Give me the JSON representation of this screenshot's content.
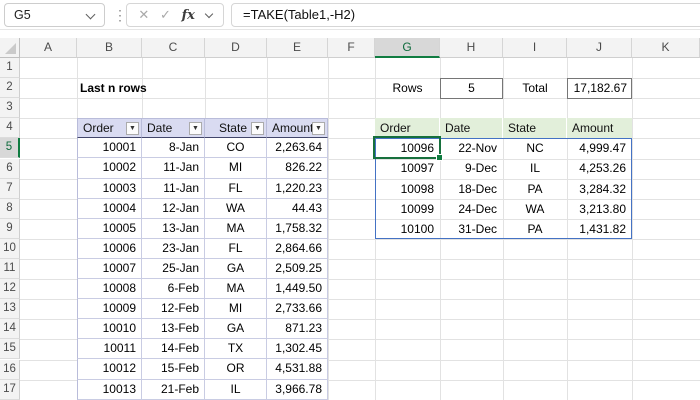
{
  "chrome": {
    "name_box": "G5",
    "formula": "=TAKE(Table1,-H2)",
    "fx_label": "fx"
  },
  "icons": {
    "cancel": "✕",
    "confirm": "✓",
    "menu_dots": "⋮",
    "filter": "▼"
  },
  "grid": {
    "column_letters": [
      "A",
      "B",
      "C",
      "D",
      "E",
      "F",
      "G",
      "H",
      "I",
      "J",
      "K"
    ],
    "row_numbers": [
      "1",
      "2",
      "3",
      "4",
      "5",
      "6",
      "7",
      "8",
      "9",
      "10",
      "11",
      "12",
      "13",
      "14",
      "15",
      "16",
      "17"
    ],
    "selected_column": "G",
    "selected_row": "5",
    "selected_cell": "G5"
  },
  "content": {
    "title": "Last n rows",
    "rows_label": "Rows",
    "rows_value": "5",
    "total_label": "Total",
    "total_value": "17,182.67"
  },
  "source_table": {
    "headers": [
      "Order",
      "Date",
      "State",
      "Amount"
    ],
    "rows": [
      [
        "10001",
        "8-Jan",
        "CO",
        "2,263.64"
      ],
      [
        "10002",
        "11-Jan",
        "MI",
        "826.22"
      ],
      [
        "10003",
        "11-Jan",
        "FL",
        "1,220.23"
      ],
      [
        "10004",
        "12-Jan",
        "WA",
        "44.43"
      ],
      [
        "10005",
        "13-Jan",
        "MA",
        "1,758.32"
      ],
      [
        "10006",
        "23-Jan",
        "FL",
        "2,864.66"
      ],
      [
        "10007",
        "25-Jan",
        "GA",
        "2,509.25"
      ],
      [
        "10008",
        "6-Feb",
        "MA",
        "1,449.50"
      ],
      [
        "10009",
        "12-Feb",
        "MI",
        "2,733.66"
      ],
      [
        "10010",
        "13-Feb",
        "GA",
        "871.23"
      ],
      [
        "10011",
        "14-Feb",
        "TX",
        "1,302.45"
      ],
      [
        "10012",
        "15-Feb",
        "OR",
        "4,531.88"
      ],
      [
        "10013",
        "21-Feb",
        "IL",
        "3,966.78"
      ]
    ]
  },
  "result_table": {
    "headers": [
      "Order",
      "Date",
      "State",
      "Amount"
    ],
    "rows": [
      [
        "10096",
        "22-Nov",
        "NC",
        "4,999.47"
      ],
      [
        "10097",
        "9-Dec",
        "IL",
        "4,253.26"
      ],
      [
        "10098",
        "18-Dec",
        "PA",
        "3,284.32"
      ],
      [
        "10099",
        "24-Dec",
        "WA",
        "3,213.80"
      ],
      [
        "10100",
        "31-Dec",
        "PA",
        "1,431.82"
      ]
    ]
  },
  "colors": {
    "accent_green": "#107C41",
    "spill_border": "#4472C4",
    "source_header_bg": "#D9DBF1",
    "result_header_bg": "#E2EFDA"
  }
}
